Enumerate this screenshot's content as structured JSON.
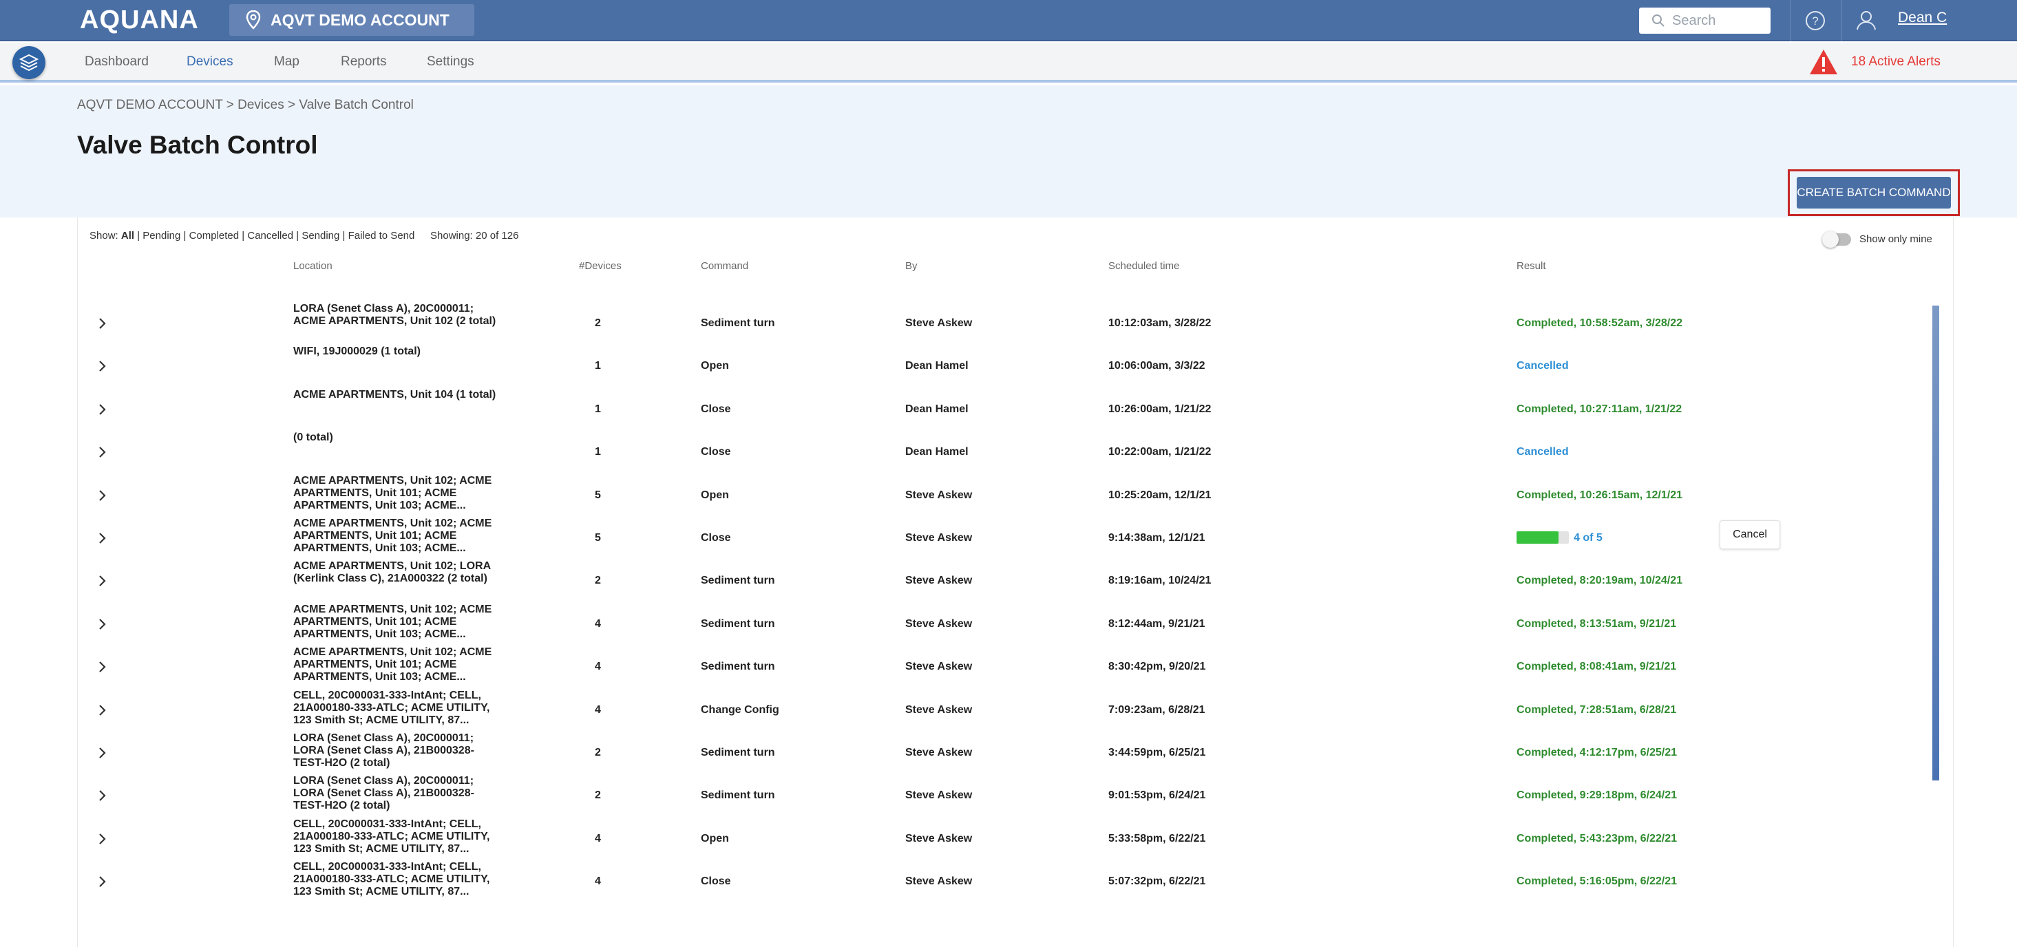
{
  "header": {
    "logo": "AQUANA",
    "account": "AQVT DEMO ACCOUNT",
    "search_placeholder": "Search",
    "user": "Dean C"
  },
  "nav": {
    "items": [
      "Dashboard",
      "Devices",
      "Map",
      "Reports",
      "Settings"
    ],
    "active": "Devices",
    "alerts": "18 Active Alerts"
  },
  "page": {
    "breadcrumb": "AQVT DEMO ACCOUNT > Devices > Valve Batch Control",
    "title": "Valve Batch Control",
    "create_button": "CREATE BATCH COMMAND"
  },
  "filters": {
    "show_label": "Show:",
    "options": [
      "All",
      "Pending",
      "Completed",
      "Cancelled",
      "Sending",
      "Failed to Send"
    ],
    "selected": "All",
    "showing": "Showing: 20 of 126",
    "show_only_mine": "Show only mine"
  },
  "table": {
    "columns": [
      "Location",
      "#Devices",
      "Command",
      "By",
      "Scheduled time",
      "Result"
    ],
    "rows": [
      {
        "location": "LORA (Senet Class A), 20C000011; ACME APARTMENTS, Unit 102 (2 total)",
        "devices": "2",
        "command": "Sediment turn",
        "by": "Steve Askew",
        "scheduled": "10:12:03am, 3/28/22",
        "result": "Completed, 10:58:52am, 3/28/22",
        "status": "completed"
      },
      {
        "location": "WIFI, 19J000029 (1 total)",
        "devices": "1",
        "command": "Open",
        "by": "Dean Hamel",
        "scheduled": "10:06:00am, 3/3/22",
        "result": "Cancelled",
        "status": "cancelled"
      },
      {
        "location": "ACME APARTMENTS, Unit 104 (1 total)",
        "devices": "1",
        "command": "Close",
        "by": "Dean Hamel",
        "scheduled": "10:26:00am, 1/21/22",
        "result": "Completed, 10:27:11am, 1/21/22",
        "status": "completed"
      },
      {
        "location": "(0 total)",
        "devices": "1",
        "command": "Close",
        "by": "Dean Hamel",
        "scheduled": "10:22:00am, 1/21/22",
        "result": "Cancelled",
        "status": "cancelled"
      },
      {
        "location": "ACME APARTMENTS, Unit 102; ACME APARTMENTS, Unit 101; ACME APARTMENTS, Unit 103; ACME...",
        "devices": "5",
        "command": "Open",
        "by": "Steve Askew",
        "scheduled": "10:25:20am, 12/1/21",
        "result": "Completed, 10:26:15am, 12/1/21",
        "status": "completed"
      },
      {
        "location": "ACME APARTMENTS, Unit 102; ACME APARTMENTS, Unit 101; ACME APARTMENTS, Unit 103; ACME...",
        "devices": "5",
        "command": "Close",
        "by": "Steve Askew",
        "scheduled": "9:14:38am, 12/1/21",
        "result": "4 of 5",
        "status": "progress",
        "progress": 0.8,
        "action": "Cancel"
      },
      {
        "location": "ACME APARTMENTS, Unit 102; LORA (Kerlink Class C), 21A000322 (2 total)",
        "devices": "2",
        "command": "Sediment turn",
        "by": "Steve Askew",
        "scheduled": "8:19:16am, 10/24/21",
        "result": "Completed, 8:20:19am, 10/24/21",
        "status": "completed"
      },
      {
        "location": "ACME APARTMENTS, Unit 102; ACME APARTMENTS, Unit 101; ACME APARTMENTS, Unit 103; ACME...",
        "devices": "4",
        "command": "Sediment turn",
        "by": "Steve Askew",
        "scheduled": "8:12:44am, 9/21/21",
        "result": "Completed, 8:13:51am, 9/21/21",
        "status": "completed"
      },
      {
        "location": "ACME APARTMENTS, Unit 102; ACME APARTMENTS, Unit 101; ACME APARTMENTS, Unit 103; ACME...",
        "devices": "4",
        "command": "Sediment turn",
        "by": "Steve Askew",
        "scheduled": "8:30:42pm, 9/20/21",
        "result": "Completed, 8:08:41am, 9/21/21",
        "status": "completed"
      },
      {
        "location": "CELL, 20C000031-333-IntAnt; CELL, 21A000180-333-ATLC; ACME UTILITY, 123 Smith St; ACME UTILITY, 87...",
        "devices": "4",
        "command": "Change Config",
        "by": "Steve Askew",
        "scheduled": "7:09:23am, 6/28/21",
        "result": "Completed, 7:28:51am, 6/28/21",
        "status": "completed"
      },
      {
        "location": "LORA (Senet Class A), 20C000011; LORA (Senet Class A), 21B000328-TEST-H2O (2 total)",
        "devices": "2",
        "command": "Sediment turn",
        "by": "Steve Askew",
        "scheduled": "3:44:59pm, 6/25/21",
        "result": "Completed, 4:12:17pm, 6/25/21",
        "status": "completed"
      },
      {
        "location": "LORA (Senet Class A), 20C000011; LORA (Senet Class A), 21B000328-TEST-H2O (2 total)",
        "devices": "2",
        "command": "Sediment turn",
        "by": "Steve Askew",
        "scheduled": "9:01:53pm, 6/24/21",
        "result": "Completed, 9:29:18pm, 6/24/21",
        "status": "completed"
      },
      {
        "location": "CELL, 20C000031-333-IntAnt; CELL, 21A000180-333-ATLC; ACME UTILITY, 123 Smith St; ACME UTILITY, 87...",
        "devices": "4",
        "command": "Open",
        "by": "Steve Askew",
        "scheduled": "5:33:58pm, 6/22/21",
        "result": "Completed, 5:43:23pm, 6/22/21",
        "status": "completed"
      },
      {
        "location": "CELL, 20C000031-333-IntAnt; CELL, 21A000180-333-ATLC; ACME UTILITY, 123 Smith St; ACME UTILITY, 87...",
        "devices": "4",
        "command": "Close",
        "by": "Steve Askew",
        "scheduled": "5:07:32pm, 6/22/21",
        "result": "Completed, 5:16:05pm, 6/22/21",
        "status": "completed"
      }
    ]
  },
  "colors": {
    "topbar": "#4a6fa5",
    "completed": "#2e8b2e",
    "cancelled": "#2d8fd5",
    "alert": "#e53935",
    "progress": "#36c23c"
  }
}
